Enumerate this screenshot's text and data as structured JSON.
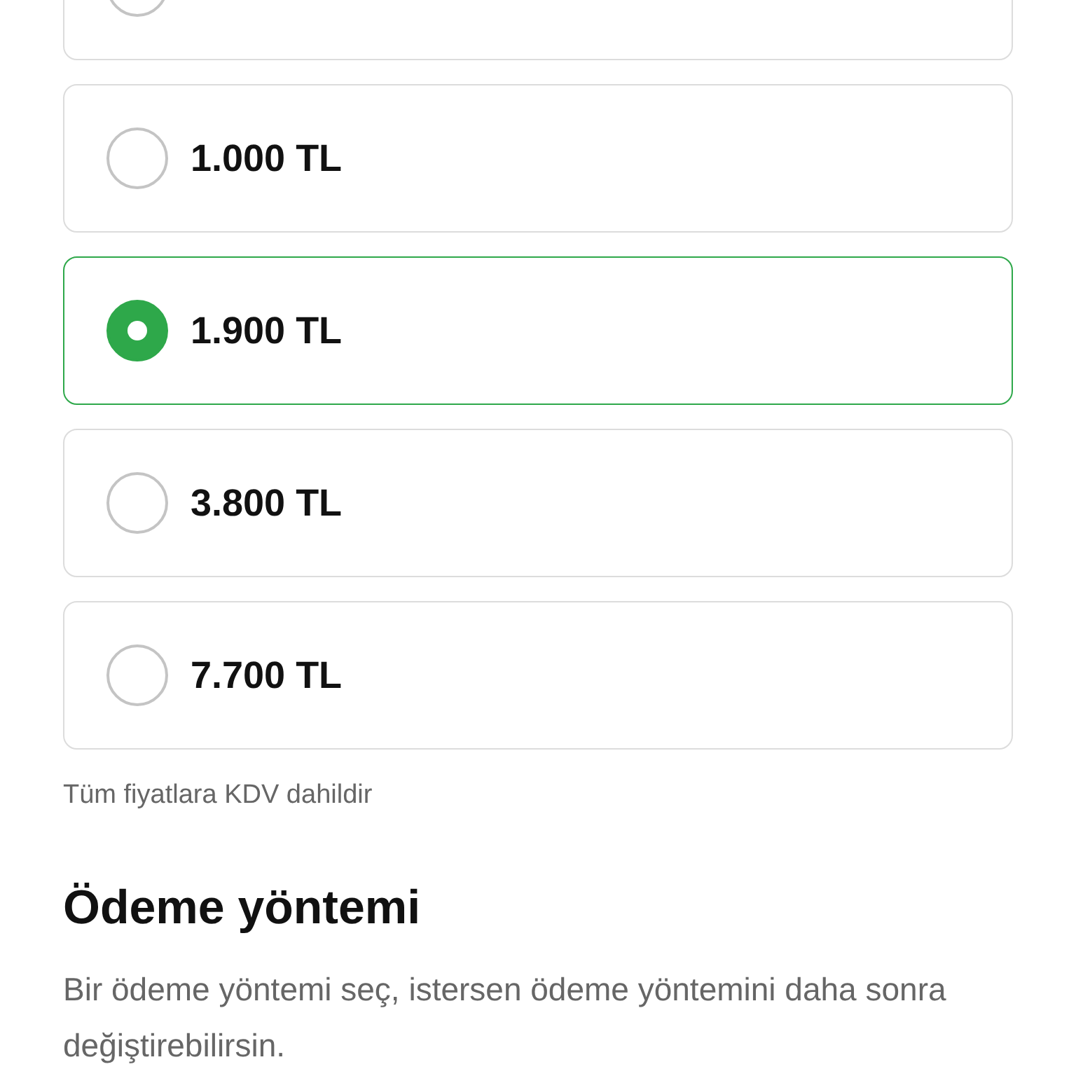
{
  "amount_options": [
    {
      "selected": false
    },
    {
      "label": "1.000 TL",
      "selected": false
    },
    {
      "label": "1.900 TL",
      "selected": true
    },
    {
      "label": "3.800 TL",
      "selected": false
    },
    {
      "label": "7.700 TL",
      "selected": false
    }
  ],
  "vat_note": "Tüm fiyatlara KDV dahildir",
  "payment_method": {
    "heading": "Ödeme yöntemi",
    "description": "Bir ödeme yöntemi seç, istersen ödeme yöntemini daha sonra değiştirebilirsin."
  }
}
